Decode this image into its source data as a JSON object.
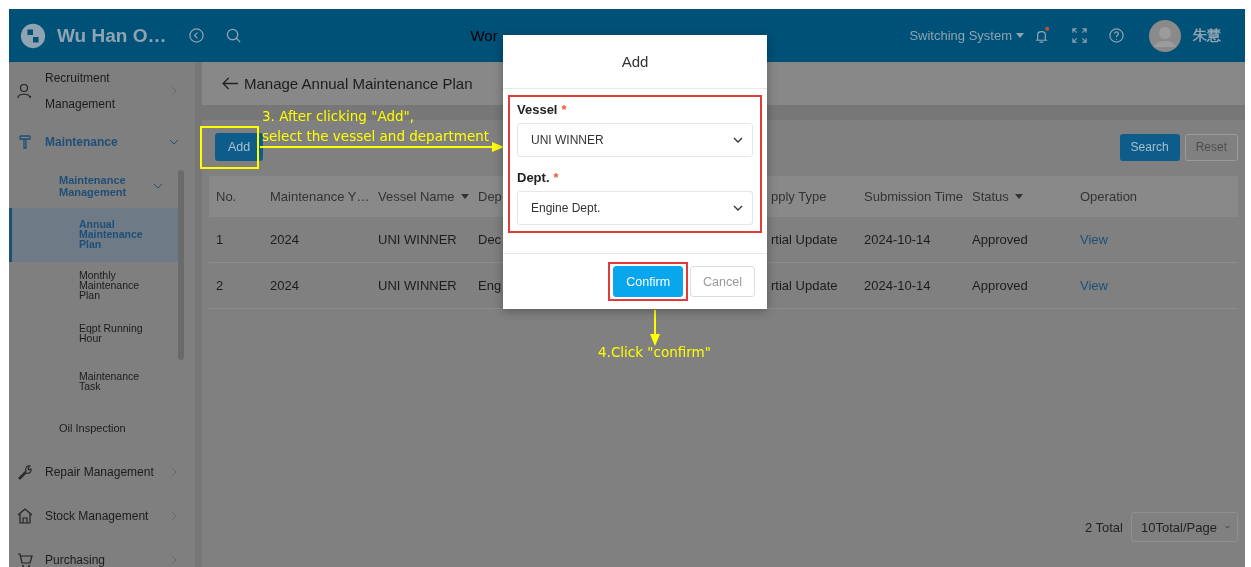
{
  "header": {
    "brand": "Wu Han O…",
    "nav": [
      {
        "label": "Wor"
      }
    ],
    "system_switch": {
      "label": "Switching System",
      "expanded": false
    },
    "notification_dot": true,
    "user_name": "朱慧"
  },
  "sidebar": {
    "items": [
      {
        "label": "Recruitment Management",
        "kind": "person",
        "expanded": false,
        "selected": false
      },
      {
        "label": "Maintenance",
        "kind": "brush",
        "expanded": true,
        "selected": false,
        "children": [
          {
            "label": "Maintenance Management",
            "expanded": true,
            "selected": false,
            "children": [
              {
                "label": "Annual Maintenance Plan",
                "selected": true
              },
              {
                "label": "Monthly Maintenance Plan",
                "selected": false
              },
              {
                "label": "Eqpt Running Hour",
                "selected": false
              },
              {
                "label": "Maintenance Task",
                "selected": false
              }
            ]
          },
          {
            "label": "Oil Inspection",
            "selected": false
          }
        ]
      },
      {
        "label": "Repair Management",
        "kind": "wrench",
        "expanded": false,
        "selected": false
      },
      {
        "label": "Stock Management",
        "kind": "house",
        "expanded": false,
        "selected": false
      },
      {
        "label": "Purchasing",
        "kind": "cart",
        "expanded": false,
        "selected": false
      }
    ]
  },
  "page": {
    "title": "Manage Annual Maintenance Plan"
  },
  "toolbar": {
    "add": "Add",
    "search": "Search",
    "reset": "Reset"
  },
  "table": {
    "columns": [
      {
        "label": "No.",
        "filter": false
      },
      {
        "label": "Maintenance Y…",
        "filter": false
      },
      {
        "label": "Vessel Name",
        "filter": true
      },
      {
        "label": "Dep",
        "filter": false
      },
      {
        "label": "pply Type",
        "filter": false
      },
      {
        "label": "Submission Time",
        "filter": false
      },
      {
        "label": "Status",
        "filter": true
      },
      {
        "label": "Operation",
        "filter": false,
        "kind": "link"
      }
    ],
    "rows": [
      [
        "1",
        "2024",
        "UNI WINNER",
        "Dec",
        "rtial Update",
        "2024-10-14",
        "Approved",
        "View"
      ],
      [
        "2",
        "2024",
        "UNI WINNER",
        "Eng",
        "rtial Update",
        "2024-10-14",
        "Approved",
        "View"
      ]
    ]
  },
  "pagination": {
    "total": "2 Total",
    "page_size": "10Total/Page"
  },
  "dialog": {
    "title": "Add",
    "fields": [
      {
        "label": "Vessel",
        "required_mark": "*",
        "value": "UNI WINNER"
      },
      {
        "label": "Dept.",
        "required_mark": "*",
        "value": "Engine Dept."
      }
    ],
    "buttons": [
      {
        "label": "Confirm",
        "kind": "primary"
      },
      {
        "label": "Cancel",
        "kind": "default"
      }
    ]
  },
  "annotations": [
    {
      "text": "3. After clicking \"Add\",\nselect the vessel and department"
    },
    {
      "text": "4.Click \"confirm\""
    }
  ]
}
